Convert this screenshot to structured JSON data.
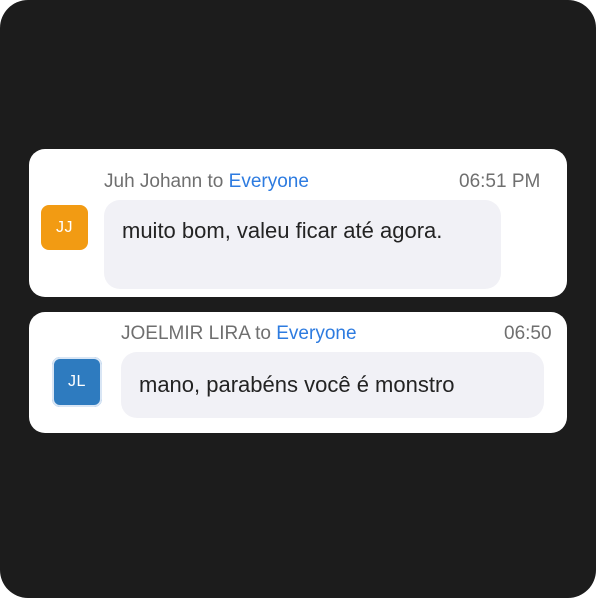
{
  "messages": [
    {
      "sender": "Juh Johann",
      "to_word": "to",
      "recipient": "Everyone",
      "time": "06:51 PM",
      "initials": "JJ",
      "avatar_color": "#f29b13",
      "text": "muito bom, valeu ficar até agora."
    },
    {
      "sender": "JOELMIR LIRA",
      "to_word": "to",
      "recipient": "Everyone",
      "time": "06:50",
      "initials": "JL",
      "avatar_color": "#2e7bbf",
      "text": "mano, parabéns você é monstro"
    }
  ],
  "colors": {
    "background": "#1c1c1c",
    "card": "#ffffff",
    "bubble": "#f1f1f6",
    "recipient_link": "#2d7be0",
    "meta_text": "#6f6f6f"
  }
}
